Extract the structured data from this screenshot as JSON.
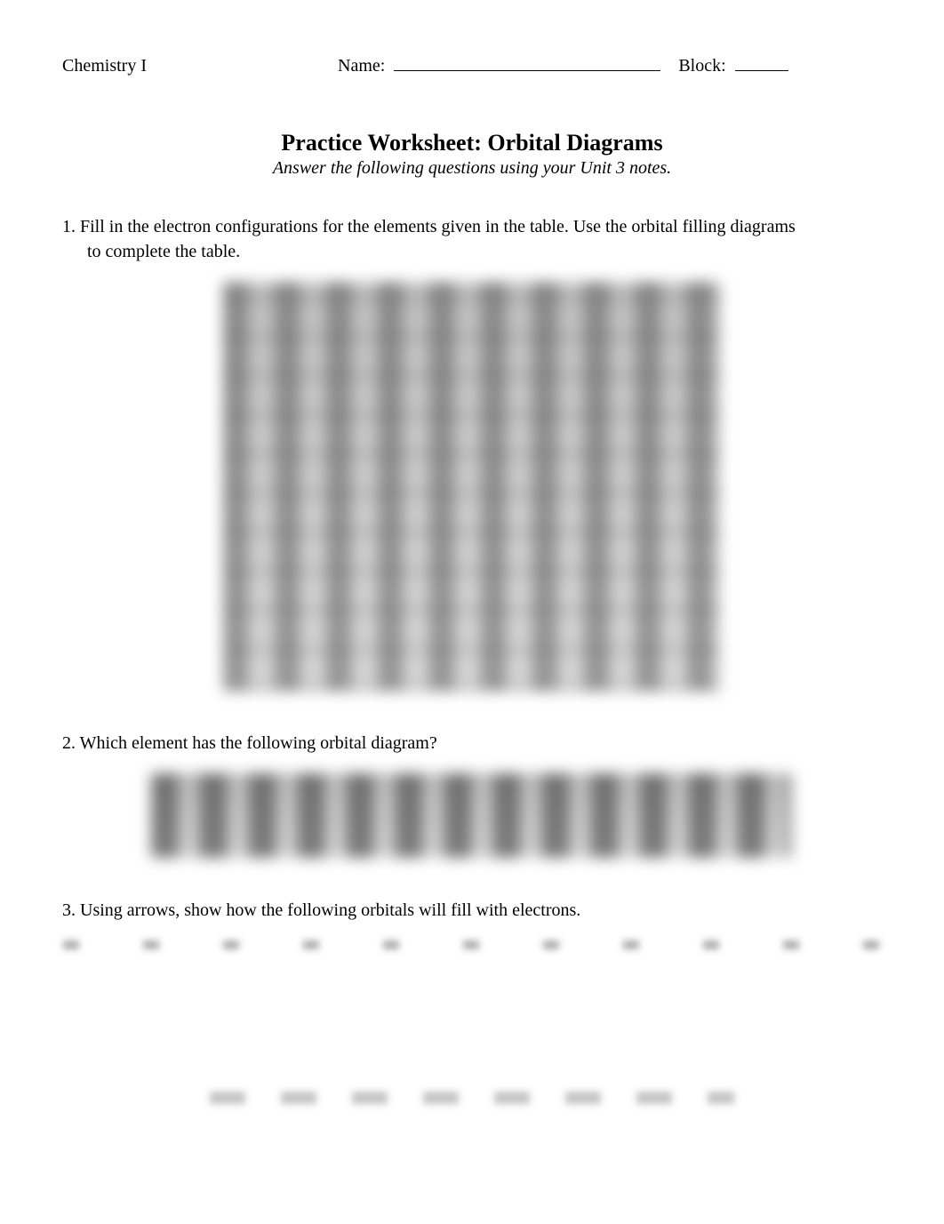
{
  "header": {
    "course": "Chemistry I",
    "name_label": "Name:",
    "block_label": "Block:"
  },
  "title": "Practice Worksheet: Orbital Diagrams",
  "subtitle": "Answer the following questions using your Unit 3 notes.",
  "questions": {
    "q1_num": "1.",
    "q1_line1": "Fill in the electron configurations for the elements given in the table.  Use the orbital filling diagrams",
    "q1_line2": "to complete the table.",
    "q2_num": "2.",
    "q2_text": "Which element has the following orbital diagram?",
    "q3_num": "3.",
    "q3_text": "Using arrows, show how the following orbitals will fill with electrons."
  }
}
